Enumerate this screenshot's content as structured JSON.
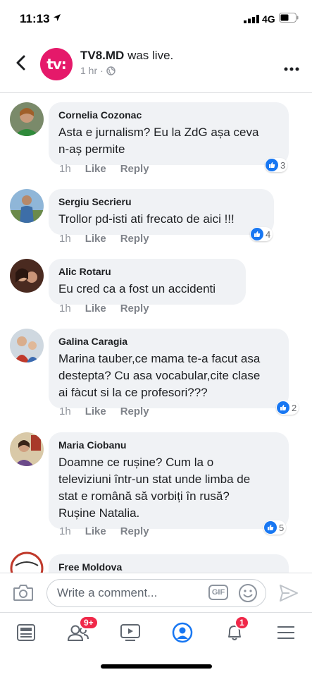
{
  "status_bar": {
    "time": "11:13",
    "network": "4G"
  },
  "header": {
    "page_avatar_text": "tv:",
    "page_name": "TV8.MD",
    "action_text": " was live.",
    "time_ago": "1 hr",
    "privacy_icon": "globe-icon"
  },
  "comments": [
    {
      "name": "Cornelia Cozonac",
      "text_lines": [
        "Asta e jurnalism? Eu la ZdG așa ceva",
        "n-aș permite"
      ],
      "time": "1h",
      "like_label": "Like",
      "reply_label": "Reply",
      "reactions": "3"
    },
    {
      "name": "Sergiu Secrieru",
      "text_lines": [
        "Trollor pd-isti  ati frecato de aici !!!"
      ],
      "time": "1h",
      "like_label": "Like",
      "reply_label": "Reply",
      "reactions": "4"
    },
    {
      "name": "Alic Rotaru",
      "text_lines": [
        "Eu cred ca a fost un accidenti"
      ],
      "time": "1h",
      "like_label": "Like",
      "reply_label": "Reply",
      "reactions": ""
    },
    {
      "name": "Galina Caragia",
      "text_lines": [
        "Marina tauber,ce mama te-a facut asa",
        "destepta?  Cu asa vocabular,cite clase",
        "ai fàcut si la ce profesori???"
      ],
      "time": "1h",
      "like_label": "Like",
      "reply_label": "Reply",
      "reactions": "2"
    },
    {
      "name": "Maria Ciobanu",
      "text_lines": [
        "Doamne ce rușine? Cum la o",
        "televiziuni într-un stat unde limba de",
        "stat e română să vorbiți în rusă?",
        "Rușine Natalia."
      ],
      "time": "1h",
      "like_label": "Like",
      "reply_label": "Reply",
      "reactions": "5"
    },
    {
      "name": "Free Moldova",
      "text_lines": [],
      "time": "",
      "like_label": "",
      "reply_label": "",
      "reactions": ""
    }
  ],
  "composer": {
    "placeholder": "Write a comment...",
    "gif_label": "GIF"
  },
  "tabbar": {
    "friends_badge": "9+",
    "notifications_badge": "1"
  },
  "colors": {
    "brand_blue": "#1877f2",
    "page_avatar": "#e5196a",
    "badge_red": "#f02849",
    "bubble": "#f0f2f5",
    "muted": "#90949c"
  }
}
